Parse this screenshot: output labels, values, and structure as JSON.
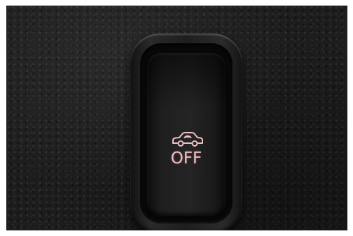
{
  "photo": {
    "subject": "car-alarm-off-switch"
  },
  "switch": {
    "label": "OFF",
    "icon": "car-alarm-icon",
    "backlight_color": "#ecc0c4"
  },
  "colors": {
    "leather": "#1d1d1d",
    "bezel": "#222222"
  }
}
